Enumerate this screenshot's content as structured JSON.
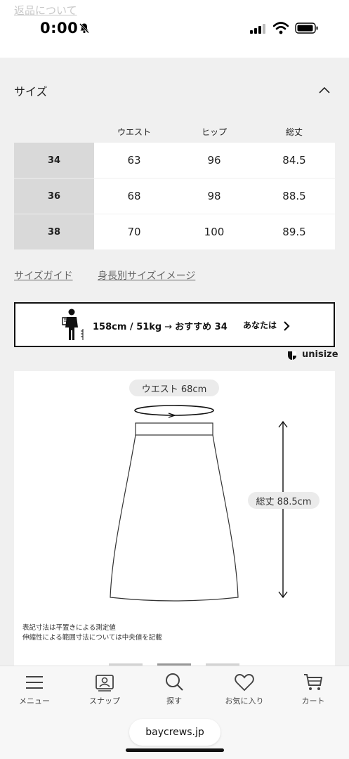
{
  "status_bar": {
    "overlay_link": "返品について",
    "time": "0:00"
  },
  "size_section": {
    "title": "サイズ",
    "columns": [
      "ウエスト",
      "ヒップ",
      "総丈"
    ],
    "rows": [
      {
        "size": "34",
        "values": [
          "63",
          "96",
          "84.5"
        ]
      },
      {
        "size": "36",
        "values": [
          "68",
          "98",
          "88.5"
        ]
      },
      {
        "size": "38",
        "values": [
          "70",
          "100",
          "89.5"
        ]
      }
    ],
    "links": [
      "サイズガイド",
      "身長別サイズイメージ"
    ]
  },
  "recommendation": {
    "profile": "158cm / 51kg",
    "arrow": "→",
    "suggestion": "おすすめ 34",
    "you_label": "あなたは"
  },
  "unisize_brand": "unisize",
  "diagram": {
    "waist_label": "ウエスト 68cm",
    "length_label": "総丈 88.5cm",
    "notes": [
      "表記寸法は平置きによる測定値",
      "伸縮性による範囲寸法については中央値を記載"
    ]
  },
  "carousel": {
    "count": 3,
    "active": 2
  },
  "bottom_nav": [
    {
      "label": "メニュー",
      "icon": "menu-icon"
    },
    {
      "label": "スナップ",
      "icon": "snap-icon"
    },
    {
      "label": "探す",
      "icon": "search-icon"
    },
    {
      "label": "お気に入り",
      "icon": "heart-icon"
    },
    {
      "label": "カート",
      "icon": "cart-icon"
    }
  ],
  "browser": {
    "url": "baycrews.jp"
  }
}
